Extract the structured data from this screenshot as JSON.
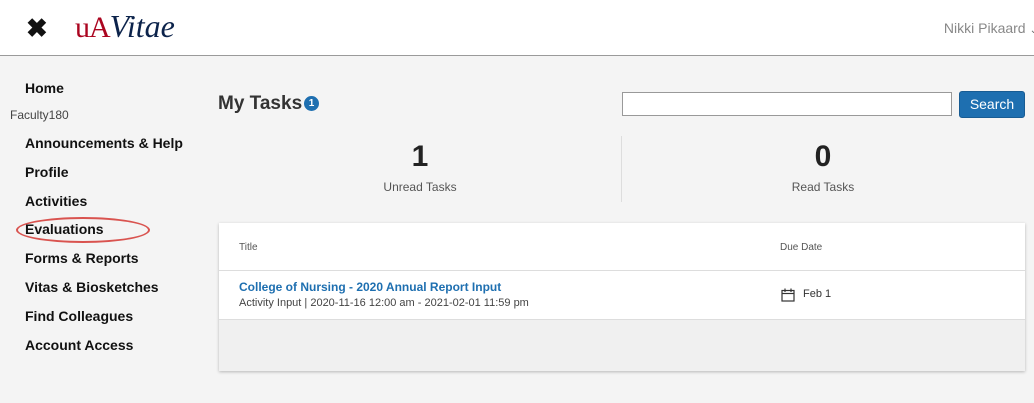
{
  "header": {
    "close_glyph": "✖",
    "logo_ua": "uA",
    "logo_vitae": "Vitae",
    "user_name": "Nikki Pikaard",
    "user_chevron": "⌄"
  },
  "sidebar": {
    "home": "Home",
    "category": "Faculty180",
    "items": [
      {
        "label": "Announcements & Help"
      },
      {
        "label": "Profile"
      },
      {
        "label": "Activities"
      },
      {
        "label": "Evaluations"
      },
      {
        "label": "Forms & Reports"
      },
      {
        "label": "Vitas & Biosketches",
        "highlighted": true
      },
      {
        "label": "Find Colleagues"
      },
      {
        "label": "Account Access"
      }
    ]
  },
  "main": {
    "title": "My Tasks",
    "badge": "1",
    "search": {
      "value": "",
      "button_label": "Search"
    },
    "stats": [
      {
        "value": "1",
        "label": "Unread Tasks"
      },
      {
        "value": "0",
        "label": "Read Tasks"
      }
    ],
    "table": {
      "columns": [
        "Title",
        "Due Date"
      ],
      "rows": [
        {
          "title": "College of Nursing - 2020 Annual Report Input",
          "subtitle": "Activity Input | 2020-11-16 12:00 am - 2021-02-01 11:59 pm",
          "due": "Feb 1",
          "due_icon": "calendar-icon"
        }
      ]
    }
  },
  "colors": {
    "accent": "#1e6fb0",
    "logo_red": "#ab0520",
    "logo_navy": "#0c234b",
    "highlight": "#d9534f"
  }
}
